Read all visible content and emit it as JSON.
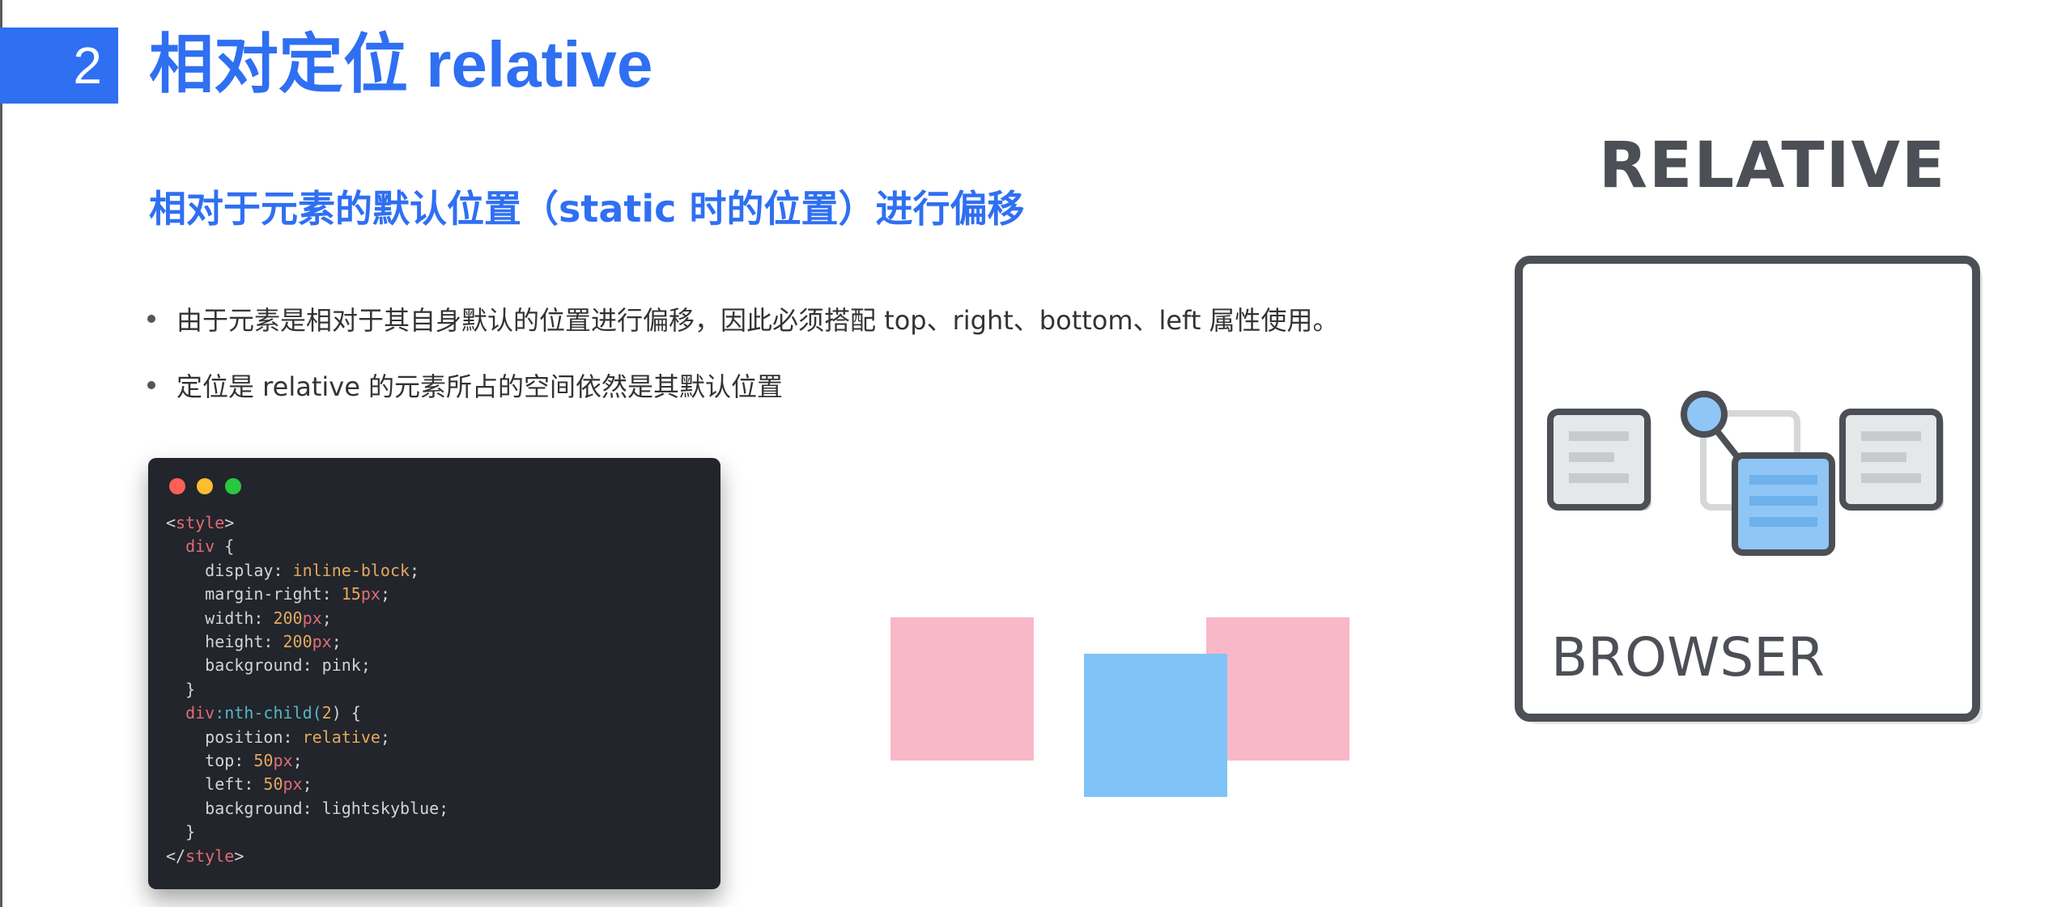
{
  "header": {
    "number": "2",
    "title": "相对定位 relative"
  },
  "subtitle": "相对于元素的默认位置（static 时的位置）进行偏移",
  "bullets": [
    "由于元素是相对于其自身默认的位置进行偏移，因此必须搭配 top、right、bottom、left 属性使用。",
    "定位是 relative 的元素所占的空间依然是其默认位置"
  ],
  "code": {
    "style_open_lt": "<",
    "style_tag": "style",
    "gt": ">",
    "selector_div": "div",
    "brace_open": " {",
    "display_prop": "display: ",
    "display_val": "inline-block",
    "margin_prop": "margin-right: ",
    "margin_num": "15",
    "width_prop": "width: ",
    "width_num": "200",
    "height_prop": "height: ",
    "height_num": "200",
    "unit_px": "px",
    "bg_pink": "background: pink;",
    "brace_close": "}",
    "selector_div2": "div",
    "pseudo": ":nth-child(",
    "pseudo_num": "2",
    "pseudo_close": ") {",
    "position_prop": "position: ",
    "position_val": "relative",
    "top_prop": "top: ",
    "top_num": "50",
    "left_prop": "left: ",
    "left_num": "50",
    "bg_blue": "background: lightskyblue;",
    "style_close_lt": "</",
    "semicolon": ";"
  },
  "illustration": {
    "heading": "RELATIVE",
    "browser_label": "BROWSER"
  },
  "colors": {
    "accent": "#2f6ff2",
    "pink": "#f8b8c7",
    "lightskyblue": "#7fc3f8",
    "code_bg": "#22252b"
  }
}
